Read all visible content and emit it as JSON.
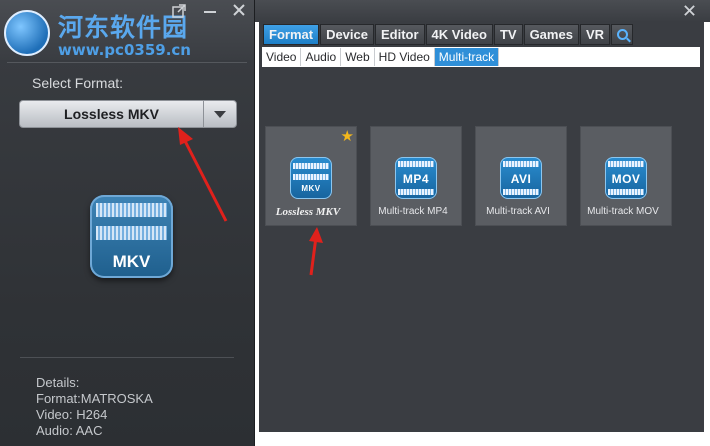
{
  "watermark": {
    "site_name": "河东软件园",
    "url": "www.pc0359.cn"
  },
  "left_panel": {
    "select_label": "Select Format:",
    "selected_format": "Lossless MKV",
    "big_icon_text": "MKV",
    "details": {
      "heading": "Details:",
      "format": "Format:MATROSKA",
      "video": "Video: H264",
      "audio": "Audio: AAC"
    }
  },
  "tabs": [
    "Format",
    "Device",
    "Editor",
    "4K Video",
    "TV",
    "Games",
    "VR"
  ],
  "active_tab": "Format",
  "subtabs": [
    "Video",
    "Audio",
    "Web",
    "HD Video",
    "Multi-track"
  ],
  "active_subtab": "Multi-track",
  "formats": [
    {
      "label": "Lossless MKV",
      "icon": "MKV",
      "starred": true
    },
    {
      "label": "Multi-track MP4",
      "icon": "MP4",
      "starred": false
    },
    {
      "label": "Multi-track AVI",
      "icon": "AVI",
      "starred": false
    },
    {
      "label": "Multi-track MOV",
      "icon": "MOV",
      "starred": false
    }
  ],
  "icons": {
    "popout": "popout-icon",
    "minimize": "minimize-icon",
    "close": "close-icon",
    "dropdown": "chevron-down-icon",
    "search": "search-icon",
    "star": "star-icon"
  },
  "colors": {
    "accent": "#2f8fd8",
    "star": "#f2b71c",
    "annotation_arrow": "#e0211c"
  }
}
